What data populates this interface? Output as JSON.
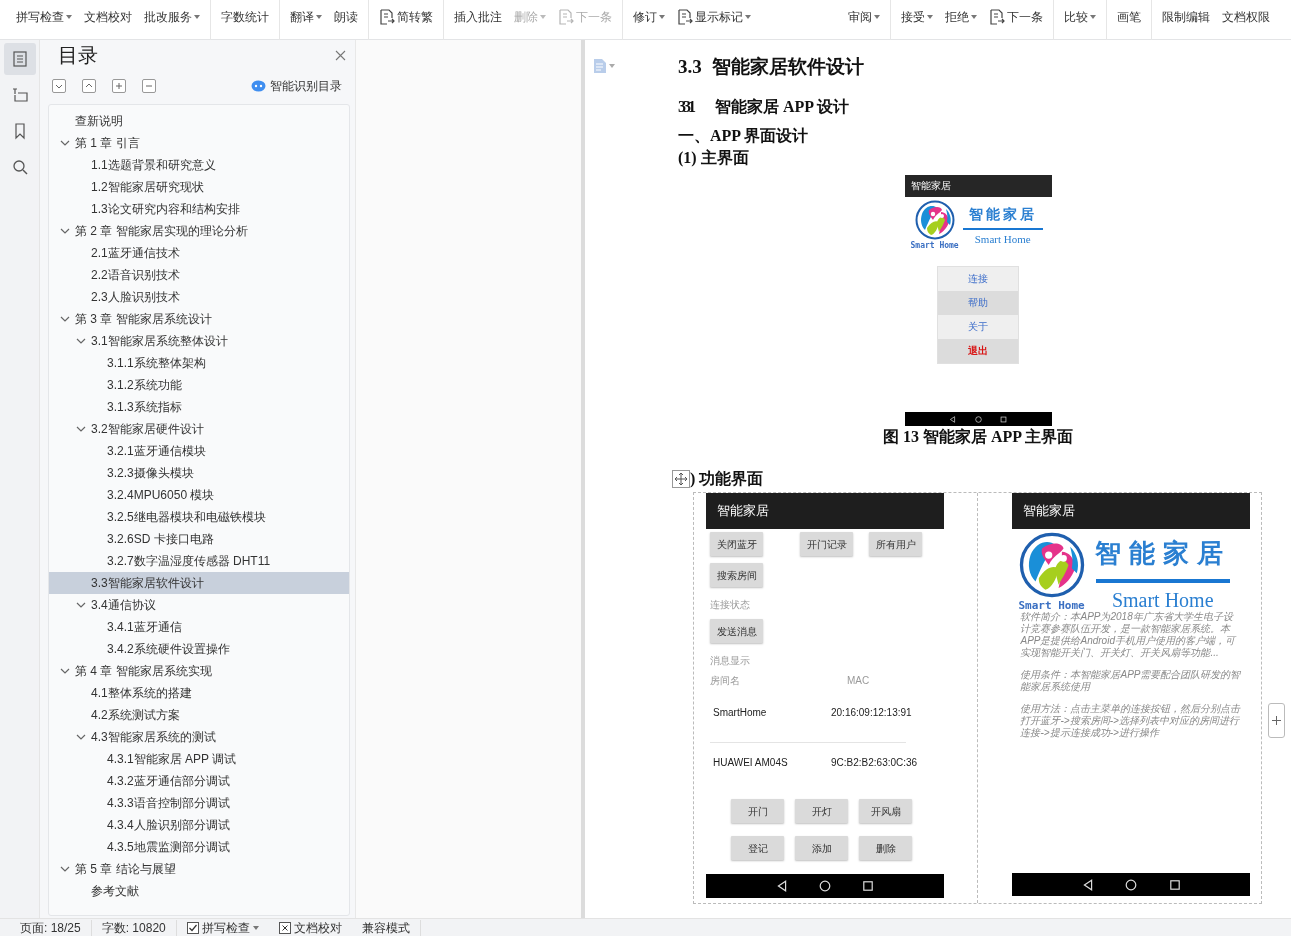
{
  "toolbar": {
    "groups": [
      [
        {
          "label": "拼写检查",
          "kind": "text",
          "dropdown": true,
          "disabled": false
        },
        {
          "label": "文档校对",
          "kind": "text",
          "dropdown": false,
          "disabled": false
        },
        {
          "label": "批改服务",
          "kind": "text",
          "dropdown": true,
          "disabled": false
        }
      ],
      [
        {
          "label": "字数统计",
          "kind": "text",
          "dropdown": false,
          "disabled": false
        }
      ],
      [
        {
          "label": "翻译",
          "kind": "text",
          "dropdown": true,
          "disabled": false
        },
        {
          "label": "朗读",
          "kind": "text",
          "dropdown": false,
          "disabled": false
        }
      ],
      [
        {
          "label": "简转繁",
          "kind": "icon",
          "dropdown": false,
          "disabled": false
        }
      ],
      [
        {
          "label": "插入批注",
          "kind": "text",
          "dropdown": false,
          "disabled": false
        },
        {
          "label": "删除",
          "kind": "text",
          "dropdown": true,
          "disabled": true
        },
        {
          "label": "下一条",
          "kind": "icon",
          "dropdown": false,
          "disabled": true
        }
      ],
      [
        {
          "label": "修订",
          "kind": "text",
          "dropdown": true,
          "disabled": false
        },
        {
          "label": "显示标记",
          "kind": "icon",
          "dropdown": true,
          "disabled": false
        },
        {
          "label": "审阅",
          "kind": "text",
          "dropdown": true,
          "disabled": false
        }
      ],
      [
        {
          "label": "接受",
          "kind": "text",
          "dropdown": true,
          "disabled": false
        },
        {
          "label": "拒绝",
          "kind": "text",
          "dropdown": true,
          "disabled": false
        },
        {
          "label": "下一条",
          "kind": "icon",
          "dropdown": false,
          "disabled": false
        }
      ],
      [
        {
          "label": "比较",
          "kind": "text",
          "dropdown": true,
          "disabled": false
        }
      ],
      [
        {
          "label": "画笔",
          "kind": "text",
          "dropdown": false,
          "disabled": false
        }
      ],
      [
        {
          "label": "限制编辑",
          "kind": "text",
          "dropdown": false,
          "disabled": false
        },
        {
          "label": "文档权限",
          "kind": "text",
          "dropdown": false,
          "disabled": false
        }
      ]
    ]
  },
  "rail": [
    {
      "selected": true
    },
    {
      "selected": false
    },
    {
      "selected": false
    },
    {
      "selected": false
    }
  ],
  "toc": {
    "title": "目录",
    "smart_button": "智能识别目录",
    "items": [
      {
        "label": "查新说明",
        "selected": false
      },
      {
        "label": "第 1 章 引言",
        "selected": false,
        "expanded": true,
        "children": [
          {
            "label": "1.1选题背景和研究意义",
            "selected": false
          },
          {
            "label": "1.2智能家居研究现状",
            "selected": false
          },
          {
            "label": "1.3论文研究内容和结构安排",
            "selected": false
          }
        ]
      },
      {
        "label": "第 2 章 智能家居实现的理论分析",
        "selected": false,
        "expanded": true,
        "children": [
          {
            "label": "2.1蓝牙通信技术",
            "selected": false
          },
          {
            "label": "2.2语音识别技术",
            "selected": false
          },
          {
            "label": "2.3人脸识别技术",
            "selected": false
          }
        ]
      },
      {
        "label": "第 3 章 智能家居系统设计",
        "selected": false,
        "expanded": true,
        "children": [
          {
            "label": "3.1智能家居系统整体设计",
            "selected": false,
            "expanded": true,
            "children": [
              {
                "label": "3.1.1系统整体架构",
                "selected": false
              },
              {
                "label": "3.1.2系统功能",
                "selected": false
              },
              {
                "label": "3.1.3系统指标",
                "selected": false
              }
            ]
          },
          {
            "label": "3.2智能家居硬件设计",
            "selected": false,
            "expanded": true,
            "children": [
              {
                "label": "3.2.1蓝牙通信模块",
                "selected": false
              },
              {
                "label": "3.2.3摄像头模块",
                "selected": false
              },
              {
                "label": "3.2.4MPU6050 模块",
                "selected": false
              },
              {
                "label": "3.2.5继电器模块和电磁铁模块",
                "selected": false
              },
              {
                "label": "3.2.6SD 卡接口电路",
                "selected": false
              },
              {
                "label": "3.2.7数字温湿度传感器 DHT11",
                "selected": false
              }
            ]
          },
          {
            "label": "3.3智能家居软件设计",
            "selected": true
          },
          {
            "label": "3.4通信协议",
            "selected": false,
            "expanded": true,
            "children": [
              {
                "label": "3.4.1蓝牙通信",
                "selected": false
              },
              {
                "label": "3.4.2系统硬件设置操作",
                "selected": false
              }
            ]
          }
        ]
      },
      {
        "label": "第 4 章 智能家居系统实现",
        "selected": false,
        "expanded": true,
        "children": [
          {
            "label": "4.1整体系统的搭建",
            "selected": false
          },
          {
            "label": "4.2系统测试方案",
            "selected": false
          },
          {
            "label": "4.3智能家居系统的测试",
            "selected": false,
            "expanded": true,
            "children": [
              {
                "label": "4.3.1智能家居 APP 调试",
                "selected": false
              },
              {
                "label": "4.3.2蓝牙通信部分调试",
                "selected": false
              },
              {
                "label": "4.3.3语音控制部分调试",
                "selected": false
              },
              {
                "label": "4.3.4人脸识别部分调试",
                "selected": false
              },
              {
                "label": "4.3.5地震监测部分调试",
                "selected": false
              }
            ]
          }
        ]
      },
      {
        "label": "第 5 章 结论与展望",
        "selected": false,
        "expanded": true,
        "children": [
          {
            "label": "参考文献",
            "selected": false
          }
        ]
      }
    ]
  },
  "document": {
    "heading": {
      "number": "3.3",
      "text": "智能家居软件设计"
    },
    "subheading": {
      "number": "331",
      "text": "智能家居 APP 设计"
    },
    "section": "一、APP 界面设计",
    "sub1": "(1) 主界面",
    "main_screen": {
      "title": "智能家居",
      "logo_text": "智能家居",
      "logo_subtitle": "Smart Home",
      "logo_badge": "Smart Home",
      "menu": [
        {
          "label": "连接",
          "danger": false
        },
        {
          "label": "帮助",
          "danger": false
        },
        {
          "label": "关于",
          "danger": false
        },
        {
          "label": "退出",
          "danger": true
        }
      ]
    },
    "caption": "图 13  智能家居 APP 主界面",
    "sub2": ") 功能界面",
    "function_screen": {
      "title": "智能家居",
      "top_buttons": [
        "关闭蓝牙",
        "开门记录",
        "所有用户",
        "搜索房间"
      ],
      "status_label": "连接状态",
      "send_button": "发送消息",
      "message_label": "消息显示",
      "columns": [
        "房间名",
        "MAC"
      ],
      "rows": [
        [
          "SmartHome",
          "20:16:09:12:13:91"
        ],
        [
          "HUAWEI  AM04S",
          "9C:B2:B2:63:0C:36"
        ]
      ],
      "control_buttons": [
        "开门",
        "开灯",
        "开风扇",
        "登记",
        "添加",
        "删除"
      ]
    },
    "about_screen": {
      "title": "智能家居",
      "logo_text": "智能家居",
      "logo_subtitle": "Smart Home",
      "logo_badge": "Smart Home",
      "paragraphs": [
        "软件简介：本APP为2018年广东省大学生电子设计竞赛参赛队伍开发，是一款智能家居系统。本APP是提供给Android手机用户使用的客户端，可实现智能开关门、开关灯、开关风扇等功能...",
        "使用条件：本智能家居APP需要配合团队研发的智能家居系统使用",
        "使用方法：点击主菜单的连接按钮，然后分别点击打开蓝牙->搜索房间->选择列表中对应的房间进行连接->提示连接成功->进行操作"
      ]
    }
  },
  "status_bar": [
    {
      "kind": "text",
      "label": "页面: 18/25"
    },
    {
      "kind": "text",
      "label": "字数: 10820"
    },
    {
      "kind": "checkbox",
      "label": "拼写检查",
      "checked": true
    },
    {
      "kind": "icon-text",
      "label": "文档校对"
    },
    {
      "kind": "text",
      "label": "兼容模式"
    }
  ]
}
